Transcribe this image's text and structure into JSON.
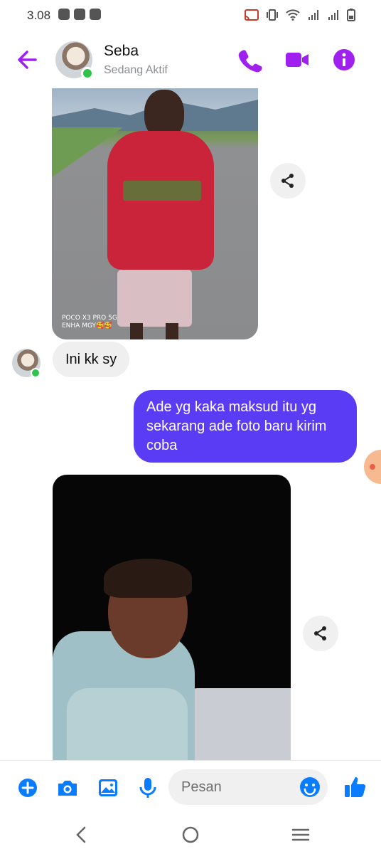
{
  "status_bar": {
    "time": "3.08",
    "notification_icons": [
      "chat-bubble-icon",
      "mail-icon",
      "youtube-icon",
      "youtube-icon"
    ],
    "system_icons": [
      "cast-icon",
      "vibrate-icon",
      "wifi-icon",
      "signal-icon",
      "signal-icon",
      "battery-icon"
    ]
  },
  "header": {
    "contact_name": "Seba",
    "contact_status": "Sedang Aktif",
    "accent_color": "#a020f0",
    "actions": [
      "back-arrow-icon",
      "phone-icon",
      "video-camera-icon",
      "info-icon"
    ]
  },
  "messages": [
    {
      "type": "image",
      "direction": "incoming",
      "watermark": "POCO X3 PRO 5G\nENHA MGY🥰🥰"
    },
    {
      "type": "text",
      "direction": "incoming",
      "text": "Ini kk sy"
    },
    {
      "type": "text",
      "direction": "outgoing",
      "text": "Ade yg kaka maksud itu yg sekarang ade foto baru kirim coba",
      "bubble_color": "#5b3cf5"
    },
    {
      "type": "image",
      "direction": "incoming"
    }
  ],
  "composer": {
    "placeholder": "Pesan",
    "icon_color": "#0a7cff",
    "actions": [
      "plus-icon",
      "camera-icon",
      "gallery-icon",
      "microphone-icon",
      "emoji-icon",
      "thumbs-up-icon"
    ]
  },
  "navbar": {
    "buttons": [
      "nav-back-icon",
      "nav-home-icon",
      "nav-recents-icon"
    ]
  }
}
